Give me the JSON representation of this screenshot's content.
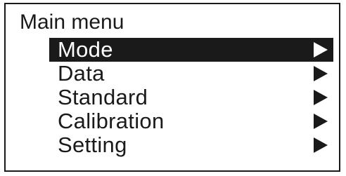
{
  "title": "Main menu",
  "selected_index": 0,
  "colors": {
    "foreground": "#1a1a1a",
    "background": "#ffffff",
    "highlight_text": "#ffffff"
  },
  "items": [
    {
      "label": "Mode",
      "icon": "triangle-right-icon"
    },
    {
      "label": "Data",
      "icon": "triangle-right-icon"
    },
    {
      "label": "Standard",
      "icon": "triangle-right-icon"
    },
    {
      "label": "Calibration",
      "icon": "triangle-right-icon"
    },
    {
      "label": "Setting",
      "icon": "triangle-right-icon"
    }
  ]
}
